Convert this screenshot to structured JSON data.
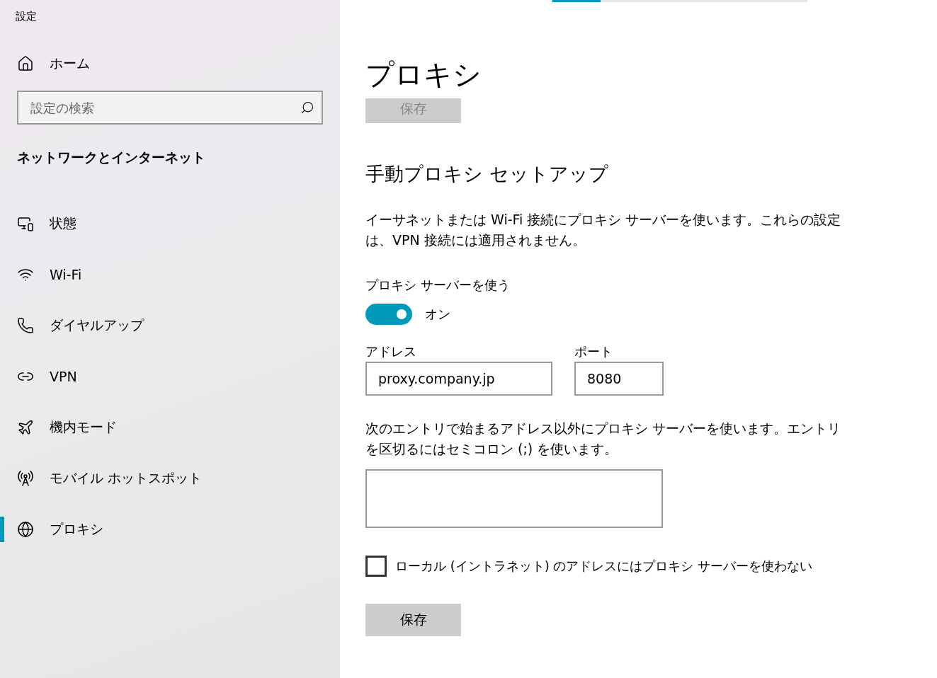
{
  "sidebar": {
    "app_title": "設定",
    "home": "ホーム",
    "search": {
      "placeholder": "設定の検索"
    },
    "section_title": "ネットワークとインターネット",
    "items": [
      {
        "label": "状態",
        "selected": false
      },
      {
        "label": "Wi-Fi",
        "selected": false
      },
      {
        "label": "ダイヤルアップ",
        "selected": false
      },
      {
        "label": "VPN",
        "selected": false
      },
      {
        "label": "機内モード",
        "selected": false
      },
      {
        "label": "モバイル ホットスポット",
        "selected": false
      },
      {
        "label": "プロキシ",
        "selected": true
      }
    ]
  },
  "main": {
    "progress": {
      "level": 0.19
    },
    "title": "プロキシ",
    "top_save": {
      "label": "保存",
      "disabled": true
    },
    "section_title": "手動プロキシ セットアップ",
    "description": "イーサネットまたは Wi-Fi 接続にプロキシ サーバーを使います。これらの設定は、VPN 接続には適用されません。",
    "use_proxy": {
      "label": "プロキシ サーバーを使う",
      "on": true,
      "state_text": "オン"
    },
    "address": {
      "label": "アドレス",
      "value": "proxy.company.jp"
    },
    "port": {
      "label": "ポート",
      "value": "8080"
    },
    "exceptions": {
      "description": "次のエントリで始まるアドレス以外にプロキシ サーバーを使います。エントリを区切るにはセミコロン (;) を使います。"
    },
    "local_bypass": {
      "label": "ローカル (イントラネット) のアドレスにはプロキシ サーバーを使わない",
      "checked": false
    },
    "save": {
      "label": "保存",
      "disabled": false
    }
  }
}
